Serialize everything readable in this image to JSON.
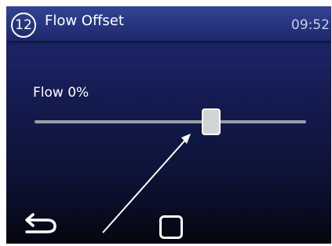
{
  "header": {
    "badge_number": "12",
    "title": "Flow Offset",
    "time": "09:52"
  },
  "slider": {
    "label": "Flow 0%",
    "value_fraction": 0.66
  },
  "nav": {
    "back_icon": "back-arrow-icon",
    "home_icon": "square-home-icon"
  }
}
